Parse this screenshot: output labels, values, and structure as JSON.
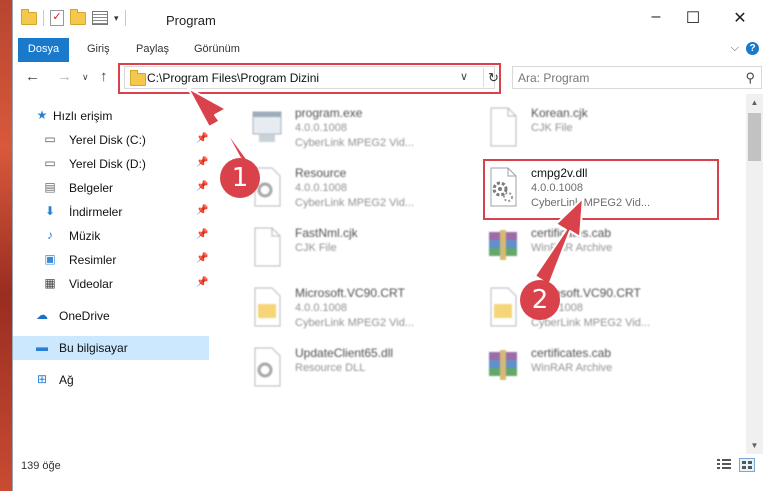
{
  "window": {
    "title": "Program",
    "minimize": "–",
    "maximize": "☐",
    "close": "✕"
  },
  "ribbon": {
    "tabs": [
      "Dosya",
      "Giriş",
      "Paylaş",
      "Görünüm"
    ],
    "help": "?"
  },
  "navigation": {
    "address": "C:\\Program Files\\Program Dizini",
    "search_placeholder": "Ara: Program"
  },
  "sidebar": {
    "items": [
      {
        "label": "Hızlı erişim",
        "icon": "star-icon",
        "pinned": false
      },
      {
        "label": "Yerel Disk (C:)",
        "icon": "drive-icon",
        "pinned": true
      },
      {
        "label": "Yerel Disk (D:)",
        "icon": "drive-icon",
        "pinned": true
      },
      {
        "label": "Belgeler",
        "icon": "documents-icon",
        "pinned": true
      },
      {
        "label": "İndirmeler",
        "icon": "download-icon",
        "pinned": true
      },
      {
        "label": "Müzik",
        "icon": "music-icon",
        "pinned": true
      },
      {
        "label": "Resimler",
        "icon": "pictures-icon",
        "pinned": true
      },
      {
        "label": "Videolar",
        "icon": "video-icon",
        "pinned": true
      },
      {
        "label": "OneDrive",
        "icon": "cloud-icon",
        "pinned": false
      },
      {
        "label": "Bu bilgisayar",
        "icon": "computer-icon",
        "pinned": false
      },
      {
        "label": "Ağ",
        "icon": "network-icon",
        "pinned": false
      }
    ]
  },
  "files": [
    {
      "name": "program.exe",
      "sub1": "4.0.0.1008",
      "sub2": "CyberLink MPEG2 Vid...",
      "type": "exe"
    },
    {
      "name": "Korean.cjk",
      "sub1": "CJK File",
      "sub2": "",
      "type": "blank"
    },
    {
      "name": "Resource",
      "sub1": "4.0.0.1008",
      "sub2": "CyberLink MPEG2 Vid...",
      "type": "gear"
    },
    {
      "name": "cmpg2v.dll",
      "sub1": "4.0.0.1008",
      "sub2": "CyberLink MPEG2 Vid...",
      "type": "gear"
    },
    {
      "name": "FastNml.cjk",
      "sub1": "CJK File",
      "sub2": "",
      "type": "blank"
    },
    {
      "name": "certificates.cab",
      "sub1": "WinRAR Archive",
      "sub2": "",
      "type": "rar"
    },
    {
      "name": "Microsoft.VC90.CRT",
      "sub1": "4.0.0.1008",
      "sub2": "CyberLink MPEG2 Vid...",
      "type": "folder"
    },
    {
      "name": "Microsoft.VC90.CRT",
      "sub1": "4.0.0.1008",
      "sub2": "CyberLink MPEG2 Vid...",
      "type": "folder"
    },
    {
      "name": "UpdateClient65.dll",
      "sub1": "Resource DLL",
      "sub2": "",
      "type": "gear"
    },
    {
      "name": "certificates.cab",
      "sub1": "WinRAR Archive",
      "sub2": "",
      "type": "rar"
    }
  ],
  "status": {
    "count": "139 öğe"
  },
  "callouts": [
    "1",
    "2"
  ],
  "colors": {
    "accent": "#1979ca",
    "highlight": "#d9424a",
    "selected": "#cce8ff"
  }
}
